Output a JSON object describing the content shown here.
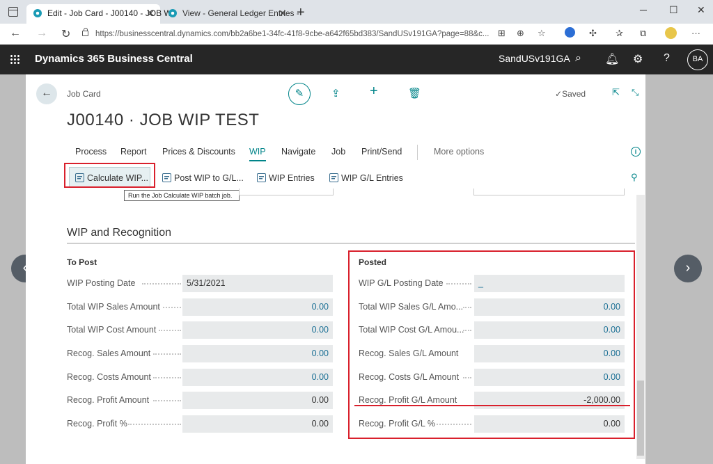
{
  "browser": {
    "tabs": [
      {
        "label": "Edit - Job Card - J00140 - JOB WI"
      },
      {
        "label": "View - General Ledger Entries - "
      }
    ],
    "url": "https://businesscentral.dynamics.com/bb2a6be1-34fc-41f8-9cbe-a642f65bd383/SandUSv191GA?page=88&c..."
  },
  "app": {
    "name": "Dynamics 365 Business Central",
    "company": "SandUSv191GA",
    "user_initials": "BA"
  },
  "page": {
    "breadcrumb": "Job Card",
    "title": "J00140 · JOB WIP TEST",
    "saved_label": "Saved",
    "menu": [
      "Process",
      "Report",
      "Prices & Discounts",
      "WIP",
      "Navigate",
      "Job",
      "Print/Send"
    ],
    "more_options": "More options",
    "actions": {
      "calculate_wip": "Calculate WIP...",
      "post_wip": "Post WIP to G/L...",
      "wip_entries": "WIP Entries",
      "wip_gl_entries": "WIP G/L Entries"
    },
    "tooltip": "Run the Job Calculate WIP batch job."
  },
  "section": {
    "title": "WIP and Recognition",
    "to_post": {
      "title": "To Post",
      "fields": [
        {
          "label": "WIP Posting Date",
          "value": "5/31/2021"
        },
        {
          "label": "Total WIP Sales Amount",
          "value": "0.00"
        },
        {
          "label": "Total WIP Cost Amount",
          "value": "0.00"
        },
        {
          "label": "Recog. Sales Amount",
          "value": "0.00"
        },
        {
          "label": "Recog. Costs Amount",
          "value": "0.00"
        },
        {
          "label": "Recog. Profit Amount",
          "value": "0.00"
        },
        {
          "label": "Recog. Profit %",
          "value": "0.00"
        }
      ]
    },
    "posted": {
      "title": "Posted",
      "fields": [
        {
          "label": "WIP G/L Posting Date",
          "value": "_"
        },
        {
          "label": "Total WIP Sales G/L Amo...",
          "value": "0.00"
        },
        {
          "label": "Total WIP Cost G/L Amou...",
          "value": "0.00"
        },
        {
          "label": "Recog. Sales G/L Amount",
          "value": "0.00"
        },
        {
          "label": "Recog. Costs G/L Amount",
          "value": "0.00"
        },
        {
          "label": "Recog. Profit G/L Amount",
          "value": "-2,000.00"
        },
        {
          "label": "Recog. Profit G/L %",
          "value": "0.00"
        }
      ]
    }
  }
}
